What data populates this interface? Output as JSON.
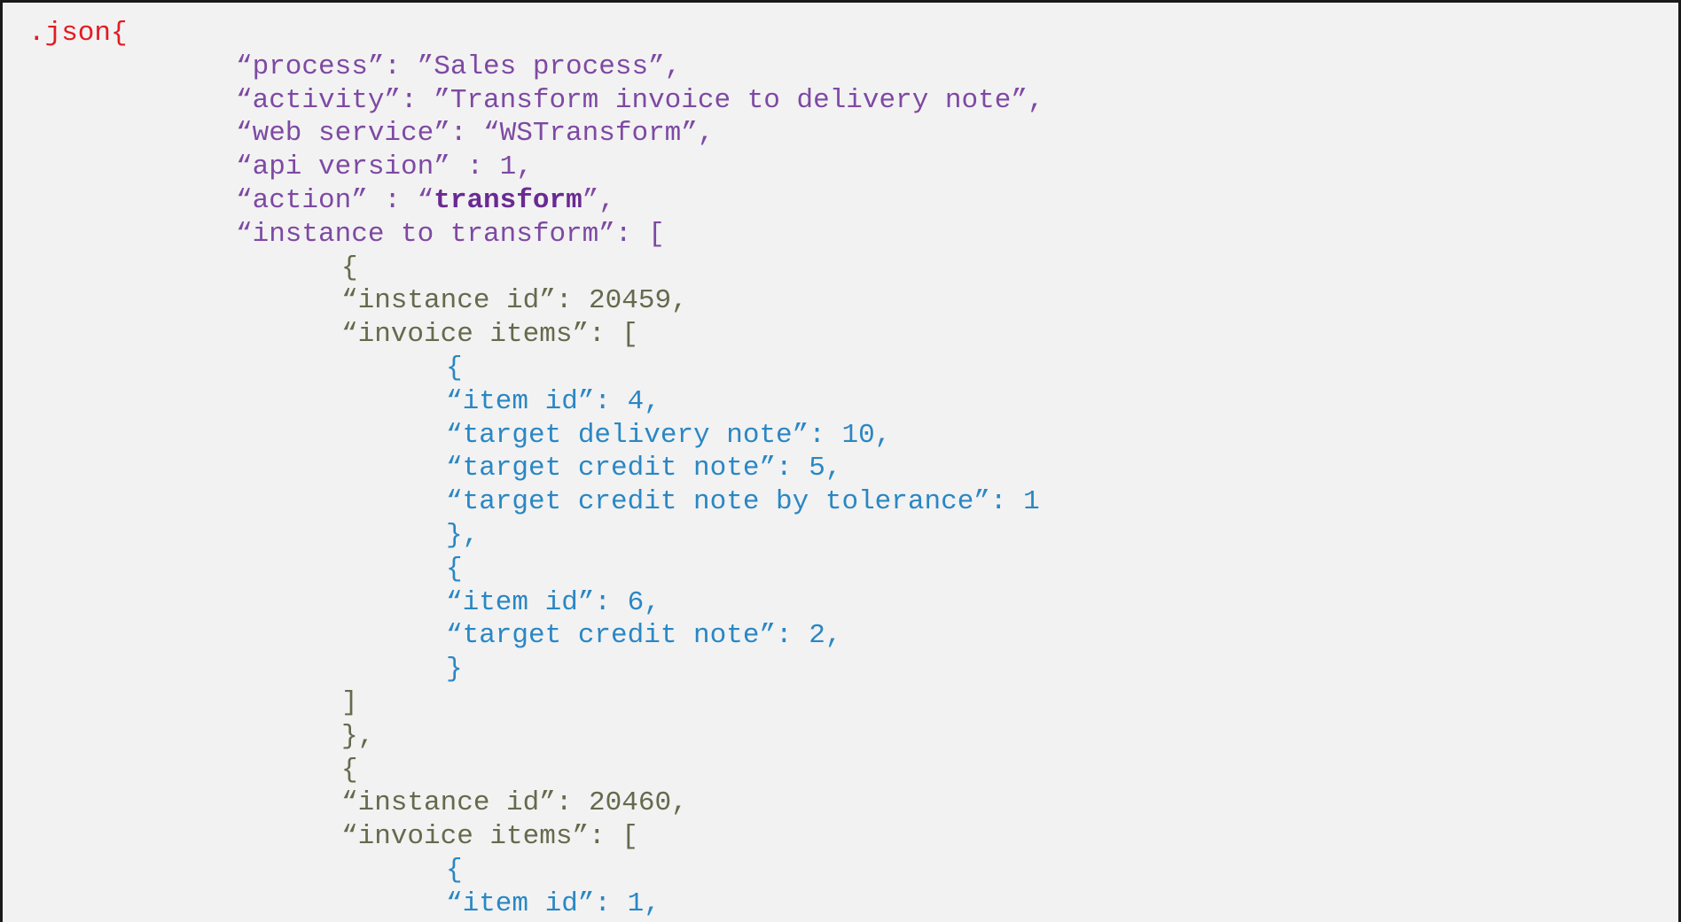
{
  "document": {
    "lines": [
      {
        "text": ".json{",
        "color": "#e31b23",
        "indent": 0
      },
      {
        "text": "“process”: ”Sales process”,",
        "color": "#7e49a3",
        "indent": 1
      },
      {
        "text": "“activity”: ”Transform invoice to delivery note”,",
        "color": "#7e49a3",
        "indent": 1
      },
      {
        "text": "“web service”: “WSTransform”,",
        "color": "#7e49a3",
        "indent": 1
      },
      {
        "text": "“api version” : 1,",
        "color": "#7e49a3",
        "indent": 1
      },
      {
        "text": "“action” : “",
        "bold": "transform",
        "after": "”,",
        "color": "#7e49a3",
        "indent": 1
      },
      {
        "text": "“instance to transform”: [",
        "color": "#7e49a3",
        "indent": 1
      },
      {
        "text": "{",
        "color": "#656a4c",
        "indent": 2
      },
      {
        "text": "“instance id”: 20459,",
        "color": "#656a4c",
        "indent": 2
      },
      {
        "text": "“invoice items”: [",
        "color": "#656a4c",
        "indent": 2
      },
      {
        "text": "{",
        "color": "#2a87c4",
        "indent": 3
      },
      {
        "text": "“item id”: 4,",
        "color": "#2a87c4",
        "indent": 3
      },
      {
        "text": "“target delivery note”: 10,",
        "color": "#2a87c4",
        "indent": 3
      },
      {
        "text": "“target credit note”: 5,",
        "color": "#2a87c4",
        "indent": 3
      },
      {
        "text": "“target credit note by tolerance”: 1",
        "color": "#2a87c4",
        "indent": 3
      },
      {
        "text": "},",
        "color": "#2a87c4",
        "indent": 3
      },
      {
        "text": "{",
        "color": "#2a87c4",
        "indent": 3
      },
      {
        "text": "“item id”: 6,",
        "color": "#2a87c4",
        "indent": 3
      },
      {
        "text": "“target credit note”: 2,",
        "color": "#2a87c4",
        "indent": 3
      },
      {
        "text": "}",
        "color": "#2a87c4",
        "indent": 3
      },
      {
        "text": "]",
        "color": "#656a4c",
        "indent": 2
      },
      {
        "text": "},",
        "color": "#656a4c",
        "indent": 2
      },
      {
        "text": "{",
        "color": "#656a4c",
        "indent": 2
      },
      {
        "text": "“instance id”: 20460,",
        "color": "#656a4c",
        "indent": 2
      },
      {
        "text": "“invoice items”: [",
        "color": "#656a4c",
        "indent": 2
      },
      {
        "text": "{",
        "color": "#2a87c4",
        "indent": 3
      },
      {
        "text": "“item id”: 1,",
        "color": "#2a87c4",
        "indent": 3
      }
    ]
  }
}
